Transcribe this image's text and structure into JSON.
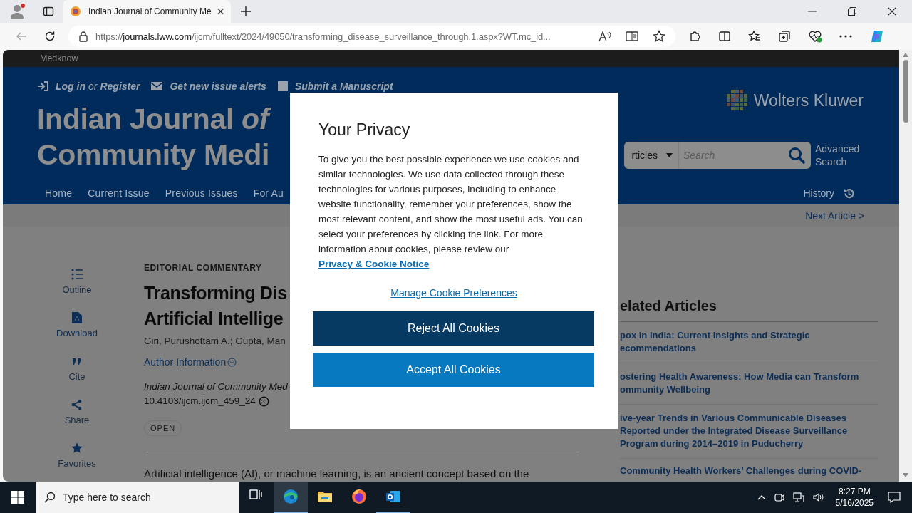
{
  "browser": {
    "tab_title": "Indian Journal of Community Me",
    "url_scheme": "https://",
    "url_host": "journals.lww.com",
    "url_path": "/ijcm/fulltext/2024/49050/transforming_disease_surveillance_through.1.aspx?WT.mc_id..."
  },
  "brand_bar": "Medknow",
  "top_links": [
    {
      "kind": "login",
      "text": "Log in"
    },
    {
      "kind": "plain",
      "text": "or"
    },
    {
      "kind": "link",
      "text": "Register"
    },
    {
      "kind": "alerts",
      "text": "Get new issue alerts"
    },
    {
      "kind": "submit",
      "text": "Submit a Manuscript"
    }
  ],
  "journal_title": {
    "line1": "Indian Journal *of*",
    "line2": "Community Medi"
  },
  "publisher_logo": "Wolters Kluwer",
  "search": {
    "scope": "rticles",
    "placeholder": "Search",
    "advanced": "Advanced Search"
  },
  "nav": [
    {
      "label": "Home"
    },
    {
      "label": "Current Issue"
    },
    {
      "label": "Previous Issues"
    },
    {
      "label": "For Au"
    }
  ],
  "history": "History",
  "next_article": "Next Article >",
  "article_tools": [
    {
      "kind": "outline",
      "label": "Outline"
    },
    {
      "kind": "download",
      "label": "Download"
    },
    {
      "kind": "cite",
      "label": "Cite"
    },
    {
      "kind": "share",
      "label": "Share"
    },
    {
      "kind": "favorites",
      "label": "Favorites"
    }
  ],
  "article": {
    "type": "EDITORIAL COMMENTARY",
    "title_lines": [
      "Transforming Dis",
      "Artificial Intellige"
    ],
    "authors": "Giri, Purushottam A.; Gupta, Man",
    "author_info": "Author Information",
    "journal": "Indian Journal of Community Med",
    "doi": "10.4103/ijcm.ijcm_459_24",
    "access": "OPEN",
    "body": "Artificial intelligence (AI), or machine learning, is an ancient concept based on the"
  },
  "related": {
    "heading": "elated Articles",
    "items": [
      {
        "lines": [
          "pox in India: Current Insights and Strategic",
          "ecommendations"
        ]
      },
      {
        "lines": [
          "ostering Health Awareness: How Media can Transform",
          "ommunity Wellbeing"
        ]
      },
      {
        "lines": [
          "ive-year Trends in Various Communicable Diseases",
          "Reported under the Integrated Disease Surveillance",
          "Program during 2014–2019 in Puducherry"
        ]
      },
      {
        "lines": [
          "Community Health Workers’ Challenges during COVID-"
        ]
      }
    ]
  },
  "cookie_dialog": {
    "title": "Your Privacy",
    "text": "To give you the best possible experience we use cookies and similar technologies. We use data collected through these technologies for various purposes, including to enhance website functionality, remember your preferences, show the most relevant content, and show the most useful ads. You can select your preferences by clicking the link. For more information about cookies, please review our",
    "link": "Privacy & Cookie Notice",
    "manage": "Manage Cookie Preferences",
    "buttons": [
      {
        "kind": "reject",
        "label": "Reject All Cookies"
      },
      {
        "kind": "accept",
        "label": "Accept All Cookies"
      }
    ]
  },
  "taskbar": {
    "search_placeholder": "Type here to search",
    "apps": [
      {
        "kind": "taskview",
        "selected": false,
        "open": false
      },
      {
        "kind": "edge",
        "selected": true,
        "open": true
      },
      {
        "kind": "explorer",
        "selected": false,
        "open": false
      },
      {
        "kind": "firefox",
        "selected": false,
        "open": false
      },
      {
        "kind": "outlook",
        "selected": false,
        "open": true
      }
    ],
    "time": "8:27 PM",
    "date": "5/16/2025"
  }
}
